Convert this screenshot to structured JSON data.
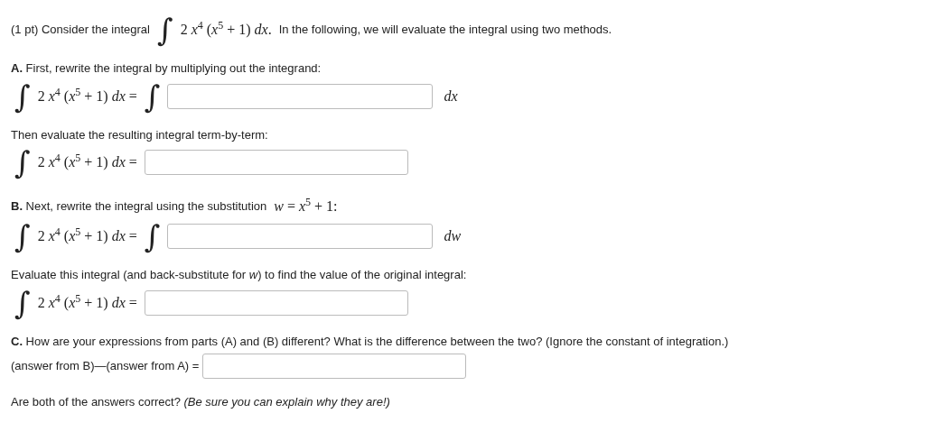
{
  "problem": [
    {
      "kind": "intro",
      "text": "(1 pt) Consider the integral",
      "integral": "∫",
      "expression": "2 *x*$^{4}$ (*x*$^{5}$ + 1) *dx*.",
      "text_after": "In the following, we will evaluate the integral using two methods."
    },
    {
      "kind": "text",
      "text": "**A.** First, rewrite the integral by multiplying out the integrand:"
    },
    {
      "kind": "equation",
      "integral": "∫",
      "expression": "2 *x*$^{4}$ (*x*$^{5}$ + 1) *dx*",
      "equals": "=",
      "inner_integral": "∫",
      "suffix": "*dx*"
    },
    {
      "kind": "text",
      "text": "Then evaluate the resulting integral term-by-term:"
    },
    {
      "kind": "equation",
      "integral": "∫",
      "expression": "2 *x*$^{4}$ (*x*$^{5}$ + 1) *dx*",
      "equals": "="
    },
    {
      "kind": "text_math",
      "text": "**B.** Next, rewrite the integral using the substitution",
      "math": "*w* = *x*$^{5}$ + 1:"
    },
    {
      "kind": "equation",
      "integral": "∫",
      "expression": "2 *x*$^{4}$ (*x*$^{5}$ + 1) *dx*",
      "equals": "=",
      "inner_integral": "∫",
      "suffix": "*dw*"
    },
    {
      "kind": "text",
      "text": "Evaluate this integral (and back-substitute for *w*) to find the value of the original integral:"
    },
    {
      "kind": "equation",
      "integral": "∫",
      "expression": "2 *x*$^{4}$ (*x*$^{5}$ + 1) *dx*",
      "equals": "="
    },
    {
      "kind": "text",
      "text": "**C.** How are your expressions from parts (A) and (B) different? What is the difference between the two? (Ignore the constant of integration.)"
    },
    {
      "kind": "answer_line",
      "text": "(answer from B)—(answer from A) ="
    },
    {
      "kind": "text",
      "text": "Are both of the answers correct? *(Be sure you can explain why they are!)*"
    }
  ]
}
